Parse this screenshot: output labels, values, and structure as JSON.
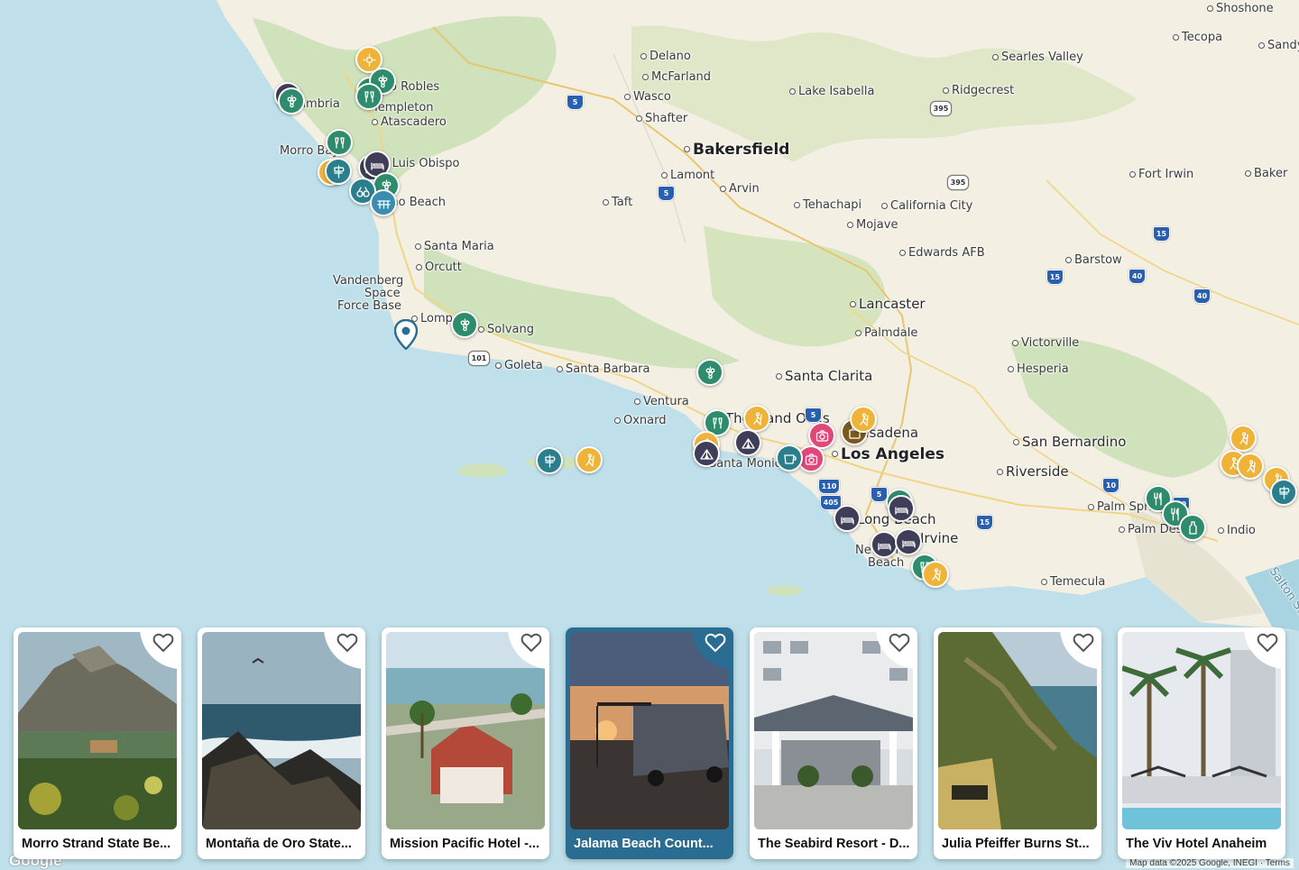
{
  "map": {
    "cities": [
      {
        "name": "Shoshone",
        "cls": "city"
      },
      {
        "name": "Tecopa",
        "cls": "city"
      },
      {
        "name": "Sandy",
        "cls": "city"
      },
      {
        "name": "Delano",
        "cls": "city"
      },
      {
        "name": "McFarland",
        "cls": "city"
      },
      {
        "name": "Searles Valley",
        "cls": "city"
      },
      {
        "name": "Paso Robles",
        "cls": "city"
      },
      {
        "name": "Wasco",
        "cls": "city"
      },
      {
        "name": "Lake Isabella",
        "cls": "city"
      },
      {
        "name": "Ridgecrest",
        "cls": "city"
      },
      {
        "name": "Cambria",
        "cls": "city"
      },
      {
        "name": "Templeton",
        "cls": "city"
      },
      {
        "name": "Shafter",
        "cls": "city"
      },
      {
        "name": "Atascadero",
        "cls": "city"
      },
      {
        "name": "Bakersfield",
        "cls": "city major"
      },
      {
        "name": "Morro Bay",
        "cls": "city"
      },
      {
        "name": "San Luis Obispo",
        "cls": "city"
      },
      {
        "name": "Lamont",
        "cls": "city"
      },
      {
        "name": "Fort Irwin",
        "cls": "city"
      },
      {
        "name": "Baker",
        "cls": "city"
      },
      {
        "name": "Arvin",
        "cls": "city"
      },
      {
        "name": "Pismo Beach",
        "cls": "city"
      },
      {
        "name": "Taft",
        "cls": "city"
      },
      {
        "name": "Tehachapi",
        "cls": "city"
      },
      {
        "name": "California City",
        "cls": "city"
      },
      {
        "name": "Mojave",
        "cls": "city"
      },
      {
        "name": "Santa Maria",
        "cls": "city"
      },
      {
        "name": "Edwards AFB",
        "cls": "city"
      },
      {
        "name": "Barstow",
        "cls": "city"
      },
      {
        "name": "Orcutt",
        "cls": "city"
      },
      {
        "name": "Vandenberg",
        "cls": "city"
      },
      {
        "name": "Space",
        "cls": "city"
      },
      {
        "name": "Force Base",
        "cls": "city"
      },
      {
        "name": "Lancaster",
        "cls": "city mid"
      },
      {
        "name": "Lompoc",
        "cls": "city"
      },
      {
        "name": "Solvang",
        "cls": "city"
      },
      {
        "name": "Palmdale",
        "cls": "city"
      },
      {
        "name": "Victorville",
        "cls": "city"
      },
      {
        "name": "Goleta",
        "cls": "city"
      },
      {
        "name": "Santa Barbara",
        "cls": "city"
      },
      {
        "name": "Hesperia",
        "cls": "city"
      },
      {
        "name": "Santa Clarita",
        "cls": "city mid"
      },
      {
        "name": "Ventura",
        "cls": "city"
      },
      {
        "name": "Oxnard",
        "cls": "city"
      },
      {
        "name": "Thousand Oaks",
        "cls": "city mid"
      },
      {
        "name": "Pasadena",
        "cls": "city mid"
      },
      {
        "name": "San Bernardino",
        "cls": "city mid"
      },
      {
        "name": "Los Angeles",
        "cls": "city major"
      },
      {
        "name": "Santa Monica",
        "cls": "city"
      },
      {
        "name": "Riverside",
        "cls": "city mid"
      },
      {
        "name": "Palm Springs",
        "cls": "city"
      },
      {
        "name": "Long Beach",
        "cls": "city mid"
      },
      {
        "name": "Palm Desert",
        "cls": "city"
      },
      {
        "name": "Indio",
        "cls": "city"
      },
      {
        "name": "Irvine",
        "cls": "city mid"
      },
      {
        "name": "Newport",
        "cls": "city"
      },
      {
        "name": "Beach",
        "cls": "city"
      },
      {
        "name": "Temecula",
        "cls": "city"
      },
      {
        "name": "Salton Sea",
        "cls": "city"
      }
    ],
    "highways": [
      {
        "num": "5",
        "type": "interstate"
      },
      {
        "num": "395",
        "type": "state"
      },
      {
        "num": "5",
        "type": "interstate"
      },
      {
        "num": "395",
        "type": "state"
      },
      {
        "num": "15",
        "type": "interstate"
      },
      {
        "num": "40",
        "type": "interstate"
      },
      {
        "num": "15",
        "type": "interstate"
      },
      {
        "num": "40",
        "type": "interstate"
      },
      {
        "num": "101",
        "type": "state"
      },
      {
        "num": "5",
        "type": "interstate"
      },
      {
        "num": "10",
        "type": "interstate"
      },
      {
        "num": "110",
        "type": "interstate"
      },
      {
        "num": "405",
        "type": "interstate"
      },
      {
        "num": "5",
        "type": "interstate"
      },
      {
        "num": "15",
        "type": "interstate"
      },
      {
        "num": "10",
        "type": "interstate"
      }
    ],
    "markers": [
      {
        "kind": "yellow",
        "icon": "sun"
      },
      {
        "kind": "dark",
        "icon": "bed"
      },
      {
        "kind": "green",
        "icon": "grapes"
      },
      {
        "kind": "green",
        "icon": "grapes"
      },
      {
        "kind": "green",
        "icon": "grapes"
      },
      {
        "kind": "green",
        "icon": "toast"
      },
      {
        "kind": "dark",
        "icon": "bed"
      },
      {
        "kind": "green",
        "icon": "toast"
      },
      {
        "kind": "yellow",
        "icon": "sun"
      },
      {
        "kind": "teal",
        "icon": "sign"
      },
      {
        "kind": "dark",
        "icon": "bed"
      },
      {
        "kind": "green",
        "icon": "grapes"
      },
      {
        "kind": "teal",
        "icon": "binoculars"
      },
      {
        "kind": "blue",
        "icon": "boardwalk"
      },
      {
        "kind": "green",
        "icon": "grapes"
      },
      {
        "kind": "green",
        "icon": "grapes"
      },
      {
        "kind": "teal",
        "icon": "sign"
      },
      {
        "kind": "yellow",
        "icon": "hiker"
      },
      {
        "kind": "green",
        "icon": "toast"
      },
      {
        "kind": "yellow",
        "icon": "hiker"
      },
      {
        "kind": "yellow",
        "icon": "hiker"
      },
      {
        "kind": "dark",
        "icon": "tent"
      },
      {
        "kind": "dark",
        "icon": "tent"
      },
      {
        "kind": "pink",
        "icon": "camera"
      },
      {
        "kind": "pink",
        "icon": "camera"
      },
      {
        "kind": "brown",
        "icon": "bag"
      },
      {
        "kind": "yellow",
        "icon": "hiker"
      },
      {
        "kind": "teal",
        "icon": "cup"
      },
      {
        "kind": "green",
        "icon": "toast"
      },
      {
        "kind": "dark",
        "icon": "bed"
      },
      {
        "kind": "dark",
        "icon": "bed"
      },
      {
        "kind": "dark",
        "icon": "bed"
      },
      {
        "kind": "dark",
        "icon": "bed"
      },
      {
        "kind": "green",
        "icon": "toast"
      },
      {
        "kind": "yellow",
        "icon": "hiker"
      },
      {
        "kind": "yellow",
        "icon": "hiker"
      },
      {
        "kind": "yellow",
        "icon": "hiker"
      },
      {
        "kind": "yellow",
        "icon": "hiker"
      },
      {
        "kind": "yellow",
        "icon": "hiker"
      },
      {
        "kind": "teal",
        "icon": "sign"
      },
      {
        "kind": "green",
        "icon": "fork"
      },
      {
        "kind": "green",
        "icon": "fork"
      },
      {
        "kind": "green",
        "icon": "bottle"
      }
    ],
    "google_logo": "Google",
    "attribution": "Map data ©2025 Google, INEGI · Terms"
  },
  "cards": [
    {
      "title": "Morro Strand State Be...",
      "scene": "morro",
      "active": false
    },
    {
      "title": "Montaña de Oro State...",
      "scene": "ocean",
      "active": false
    },
    {
      "title": "Mission Pacific Hotel -...",
      "scene": "hotel-coast",
      "active": false
    },
    {
      "title": "Jalama Beach Count...",
      "scene": "sunset-van",
      "active": true
    },
    {
      "title": "The Seabird Resort - D...",
      "scene": "resort",
      "active": false
    },
    {
      "title": "Julia Pfeiffer Burns St...",
      "scene": "cliffs",
      "active": false
    },
    {
      "title": "The Viv Hotel Anaheim",
      "scene": "palms",
      "active": false
    }
  ],
  "colors": {
    "ocean": "#bfe0ea",
    "land": "#f3efe3",
    "park": "#c9dfb8",
    "active_card": "#2b6d92"
  }
}
